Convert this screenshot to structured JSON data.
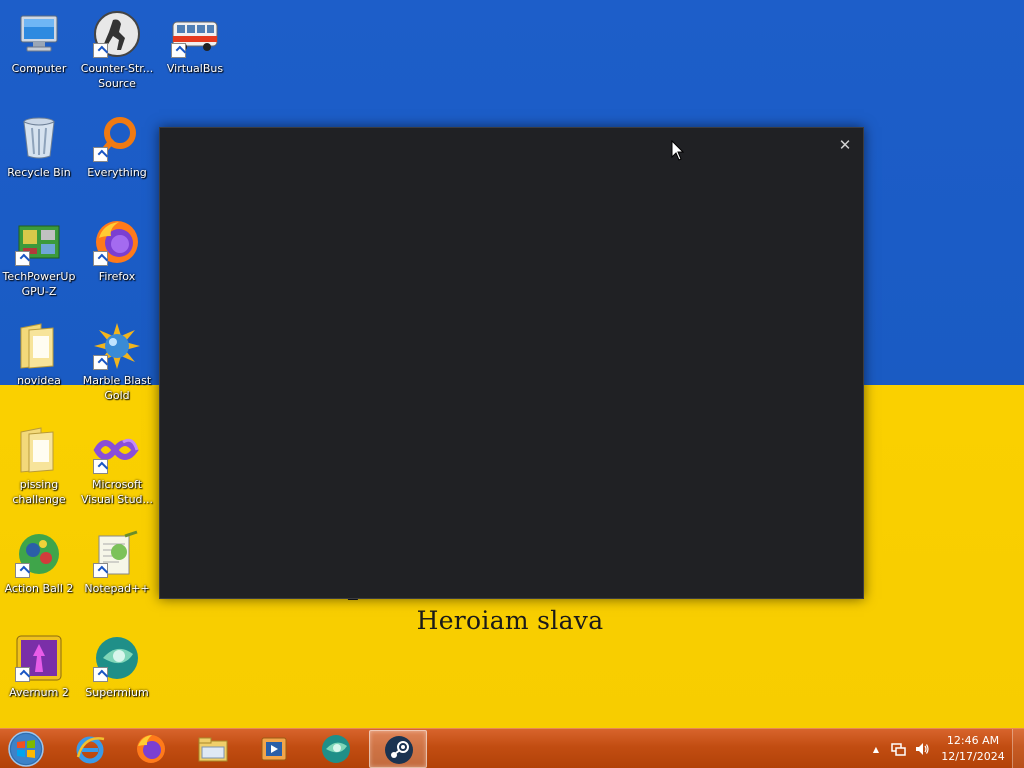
{
  "wallpaper": {
    "slogan": "Heroiam slava",
    "colors": {
      "blue": "#1d5ec9",
      "yellow": "#fad000"
    }
  },
  "desktop_icons": [
    {
      "name": "computer",
      "line1": "Computer",
      "line2": "",
      "icon": "computer-icon",
      "shortcut": false
    },
    {
      "name": "counter-strike-source",
      "line1": "Counter-Str...",
      "line2": "Source",
      "icon": "counter-strike-icon",
      "shortcut": true
    },
    {
      "name": "virtualbus",
      "line1": "VirtualBus",
      "line2": "",
      "icon": "bus-icon",
      "shortcut": true
    },
    {
      "name": "recycle-bin",
      "line1": "Recycle Bin",
      "line2": "",
      "icon": "recycle-bin-icon",
      "shortcut": false
    },
    {
      "name": "everything",
      "line1": "Everything",
      "line2": "",
      "icon": "everything-search-icon",
      "shortcut": true
    },
    {
      "name": "gpu-z",
      "line1": "TechPowerUp",
      "line2": "GPU-Z",
      "icon": "gpu-z-icon",
      "shortcut": true
    },
    {
      "name": "firefox",
      "line1": "Firefox",
      "line2": "",
      "icon": "firefox-icon",
      "shortcut": true
    },
    {
      "name": "novidea",
      "line1": "novidea",
      "line2": "",
      "icon": "folder-icon",
      "shortcut": false
    },
    {
      "name": "marble-blast-gold",
      "line1": "Marble Blast",
      "line2": "Gold",
      "icon": "marble-blast-icon",
      "shortcut": true
    },
    {
      "name": "pissing-challenge",
      "line1": "pissing",
      "line2": "challenge",
      "icon": "folder-icon",
      "shortcut": false
    },
    {
      "name": "visual-studio",
      "line1": "Microsoft",
      "line2": "Visual Stud...",
      "icon": "visual-studio-icon",
      "shortcut": true
    },
    {
      "name": "action-ball-2",
      "line1": "Action Ball 2",
      "line2": "",
      "icon": "action-ball-icon",
      "shortcut": true
    },
    {
      "name": "notepad-plus-plus",
      "line1": "Notepad++",
      "line2": "",
      "icon": "notepad-plus-plus-icon",
      "shortcut": true
    },
    {
      "name": "avernum-2",
      "line1": "Avernum 2",
      "line2": "",
      "icon": "avernum-icon",
      "shortcut": true
    },
    {
      "name": "supermium",
      "line1": "Supermium",
      "line2": "",
      "icon": "supermium-icon",
      "shortcut": true
    }
  ],
  "dark_window": {
    "close_glyph": "✕",
    "background": "#202124"
  },
  "taskbar": {
    "start_icon": "windows-start-icon",
    "pinned": [
      {
        "name": "internet-explorer",
        "icon": "internet-explorer-icon",
        "active": false
      },
      {
        "name": "firefox",
        "icon": "firefox-icon",
        "active": false
      },
      {
        "name": "file-explorer",
        "icon": "file-explorer-icon",
        "active": false
      },
      {
        "name": "media-player",
        "icon": "media-player-icon",
        "active": false
      },
      {
        "name": "supermium",
        "icon": "supermium-icon",
        "active": false
      },
      {
        "name": "steam",
        "icon": "steam-icon",
        "active": true
      }
    ],
    "tray": {
      "overflow_glyph": "▲",
      "icons": [
        "network-icon",
        "volume-icon"
      ]
    },
    "clock": {
      "time": "12:46 AM",
      "date": "12/17/2024"
    },
    "color": "#c24d12"
  }
}
